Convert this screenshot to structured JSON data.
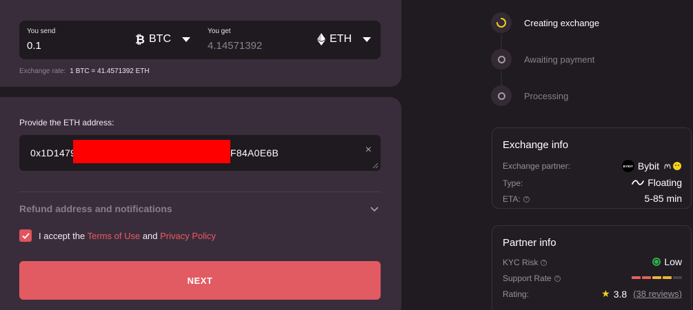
{
  "swap": {
    "send_label": "You send",
    "send_value": "0.1",
    "send_coin": "BTC",
    "get_label": "You get",
    "get_value": "4.14571392",
    "get_coin": "ETH",
    "rate_label": "Exchange rate:",
    "rate_value": "1 BTC = 41.4571392 ETH"
  },
  "address": {
    "label": "Provide the ETH address:",
    "value_start": "0x1D1479",
    "value_end": "F84A0E6B",
    "clear_glyph": "×"
  },
  "refund": {
    "label": "Refund address and notifications"
  },
  "terms": {
    "prefix": "I accept the",
    "terms_link": "Terms of Use",
    "and": "and",
    "privacy_link": "Privacy Policy"
  },
  "next_button": "NEXT",
  "steps": [
    {
      "label": "Creating exchange",
      "state": "active"
    },
    {
      "label": "Awaiting payment",
      "state": "pending"
    },
    {
      "label": "Processing",
      "state": "pending"
    }
  ],
  "exchange_info": {
    "title": "Exchange info",
    "partner_label": "Exchange partner:",
    "partner_value": "Bybit",
    "partner_logo_text": "BYBIT",
    "type_label": "Type:",
    "type_value": "Floating",
    "eta_label": "ETA:",
    "eta_value": "5-85 min"
  },
  "partner_info": {
    "title": "Partner info",
    "kyc_label": "KYC Risk",
    "kyc_value": "Low",
    "support_label": "Support Rate",
    "support_segments": [
      "#e2625a",
      "#e2625a",
      "#f0b33a",
      "#f0b33a",
      "#4a3f4b"
    ],
    "rating_label": "Rating:",
    "rating_value": "3.8",
    "reviews": "(38 reviews)"
  },
  "colors": {
    "accent": "#e35b62",
    "card": "#3a2d3b",
    "background": "#1f1b20"
  }
}
